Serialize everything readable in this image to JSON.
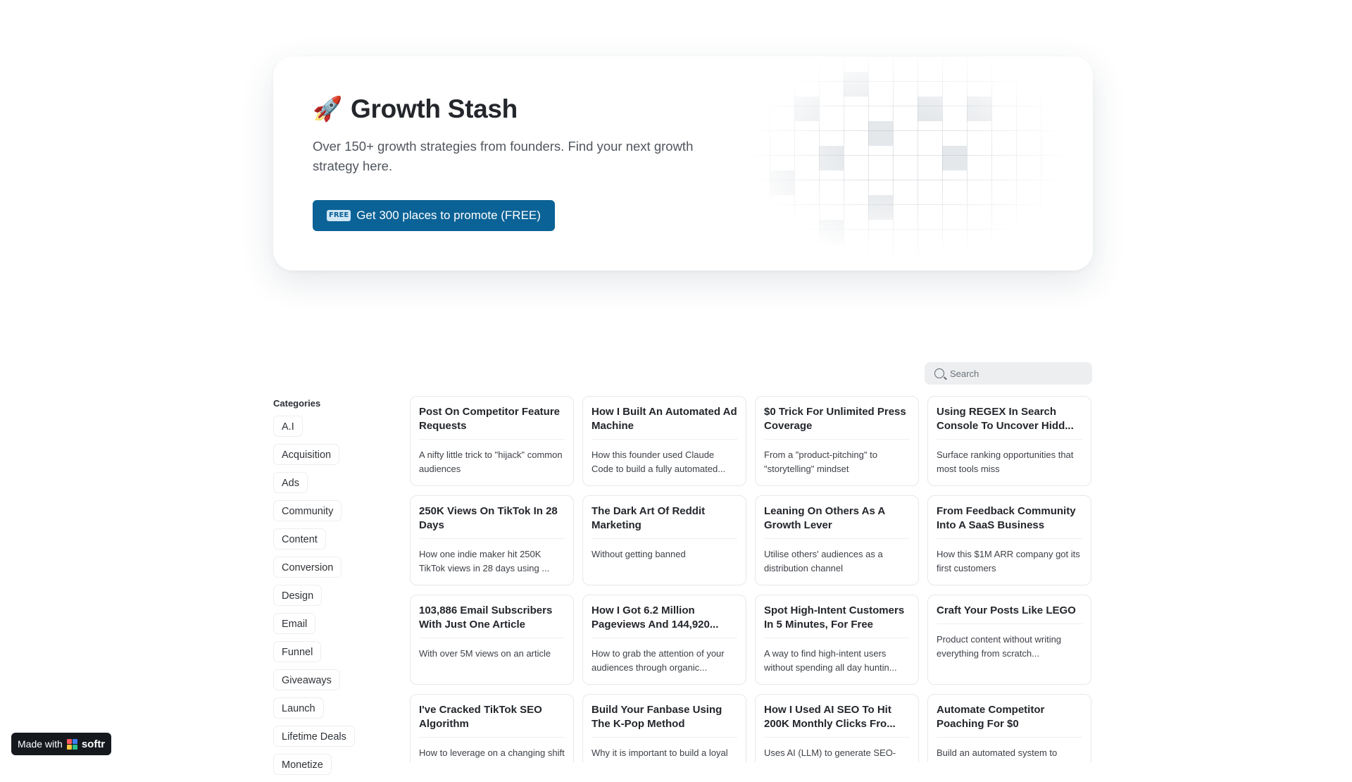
{
  "hero": {
    "icon": "rocket-icon",
    "title": "Growth Stash",
    "subtitle": "Over 150+ growth strategies from founders. Find your next growth strategy here.",
    "cta_badge": "FREE",
    "cta_label": "Get 300 places to promote (FREE)"
  },
  "search": {
    "placeholder": "Search"
  },
  "categories": {
    "heading": "Categories",
    "items": [
      "A.I",
      "Acquisition",
      "Ads",
      "Community",
      "Content",
      "Conversion",
      "Design",
      "Email",
      "Funnel",
      "Giveaways",
      "Launch",
      "Lifetime Deals",
      "Monetize"
    ]
  },
  "cards": [
    {
      "title": "Post On Competitor Feature Requests",
      "desc": "A nifty little trick to \"hijack\" common audiences"
    },
    {
      "title": "How I Built An Automated Ad Machine",
      "desc": "How this founder used Claude Code to build a fully automated..."
    },
    {
      "title": "$0 Trick For Unlimited Press Coverage",
      "desc": "From a \"product-pitching\" to \"storytelling\" mindset"
    },
    {
      "title": "Using REGEX In Search Console To Uncover Hidd...",
      "desc": "Surface ranking opportunities that most tools miss"
    },
    {
      "title": "250K Views On TikTok In 28 Days",
      "desc": "How one indie maker hit 250K TikTok views in 28 days using ..."
    },
    {
      "title": "The Dark Art Of Reddit Marketing",
      "desc": "Without getting banned"
    },
    {
      "title": "Leaning On Others As A Growth Lever",
      "desc": "Utilise others' audiences as a distribution channel"
    },
    {
      "title": "From Feedback Community Into A SaaS Business",
      "desc": "How this $1M ARR company got its first customers"
    },
    {
      "title": "103,886 Email Subscribers With Just One Article",
      "desc": "With over 5M views on an article"
    },
    {
      "title": "How I Got 6.2 Million Pageviews And 144,920...",
      "desc": "How to grab the attention of your audiences through organic..."
    },
    {
      "title": "Spot High-Intent Customers In 5 Minutes, For Free",
      "desc": "A way to find high-intent users without spending all day huntin..."
    },
    {
      "title": "Craft Your Posts Like LEGO",
      "desc": "Product content without writing everything from scratch..."
    },
    {
      "title": "I've Cracked TikTok SEO Algorithm",
      "desc": "How to leverage on a changing shift in the way people search f..."
    },
    {
      "title": "Build Your Fanbase Using The K-Pop Method",
      "desc": "Why it is important to build a loyal community of superfans..."
    },
    {
      "title": "How I Used AI SEO To Hit 200K Monthly Clicks Fro...",
      "desc": "Uses AI (LLM) to generate SEO-optimized pages automatically..."
    },
    {
      "title": "Automate Competitor Poaching For $0",
      "desc": "Build an automated system to identify users of your..."
    }
  ],
  "badge": {
    "prefix": "Made with",
    "brand": "softr",
    "logo_colors": [
      "#ff5a5f",
      "#3d7cf5",
      "#ffc53d",
      "#28c28b"
    ]
  },
  "colors": {
    "primary_button": "#0b6296",
    "card_border": "#e6e8eb",
    "badge_background": "#15191e"
  }
}
